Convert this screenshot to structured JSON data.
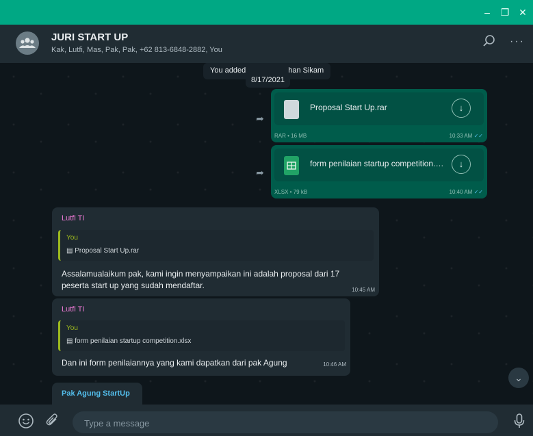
{
  "colors": {
    "accent": "#00a884",
    "outgoing": "#005c4b",
    "incoming": "#202c33",
    "sender_lutfi": "#ee7ad6",
    "sender_agung": "#53bdeb",
    "quote": "#9cb91e"
  },
  "window": {
    "controls": [
      "minimize-icon",
      "maximize-icon",
      "close-icon"
    ]
  },
  "header": {
    "title": "JURI START UP",
    "participants": "Kak, Lutfi, Mas, Pak, Pak, +62 813-6848-2882, You",
    "icons": [
      "group-avatar-icon",
      "search-icon",
      "more-icon"
    ]
  },
  "chat": {
    "system_left": "You added",
    "system_right": "han Sikam",
    "date": "8/17/2021",
    "files": [
      {
        "name": "Proposal Start Up.rar",
        "meta": "RAR • 16 MB",
        "time": "10:33 AM",
        "icon": "file-icon"
      },
      {
        "name": "form penilaian startup competition.xlsx",
        "meta": "XLSX • 79 kB",
        "time": "10:40 AM",
        "icon": "spreadsheet-icon"
      }
    ],
    "messages": [
      {
        "sender": "Lutfi TI",
        "quote_name": "You",
        "quote_file": "Proposal Start Up.rar",
        "text1": "Assalamualaikum pak, kami ingin menyampaikan ini adalah  proposal dari 17",
        "text2": "peserta start up yang sudah mendaftar.",
        "time": "10:45 AM"
      },
      {
        "sender": "Lutfi TI",
        "quote_name": "You",
        "quote_file": "form penilaian startup competition.xlsx",
        "text1": "Dan ini form penilaiannya yang kami dapatkan dari pak Agung",
        "time": "10:46 AM"
      },
      {
        "sender": "Pak Agung StartUp"
      }
    ]
  },
  "footer": {
    "placeholder": "Type a message",
    "icons": [
      "emoji-icon",
      "attach-icon",
      "mic-icon"
    ]
  }
}
